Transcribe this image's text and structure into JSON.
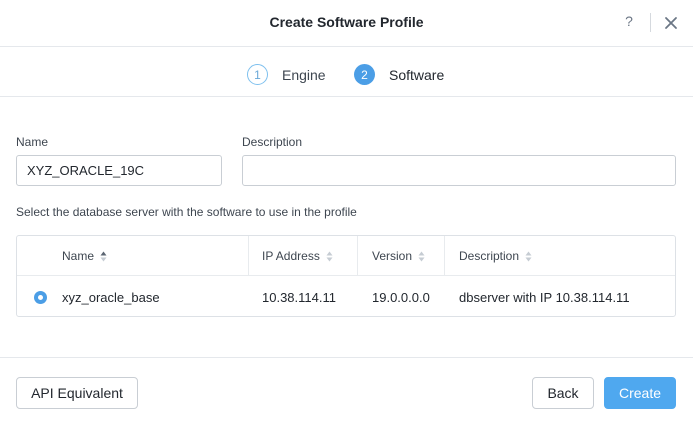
{
  "dialog": {
    "title": "Create Software Profile",
    "help_label": "?"
  },
  "steps": [
    {
      "number": "1",
      "label": "Engine",
      "state": "completed"
    },
    {
      "number": "2",
      "label": "Software",
      "state": "active"
    }
  ],
  "form": {
    "name_label": "Name",
    "name_value": "XYZ_ORACLE_19C",
    "description_label": "Description",
    "description_value": "",
    "instructions": "Select the database server with the software to use in the profile"
  },
  "table": {
    "columns": [
      "Name",
      "IP Address",
      "Version",
      "Description"
    ],
    "sorted_column": "Name",
    "rows": [
      {
        "selected": true,
        "name": "xyz_oracle_base",
        "ip": "10.38.114.11",
        "version": "19.0.0.0.0",
        "description": "dbserver with IP 10.38.114.11"
      }
    ]
  },
  "footer": {
    "api_label": "API Equivalent",
    "back_label": "Back",
    "create_label": "Create"
  },
  "colors": {
    "accent": "#4b9ee6",
    "primary_button": "#4fa8ef",
    "border": "#c9ced4"
  },
  "icons": {
    "close": "close-icon",
    "help": "help-icon",
    "sort": "sort-icon",
    "radio": "radio-selected-icon"
  }
}
